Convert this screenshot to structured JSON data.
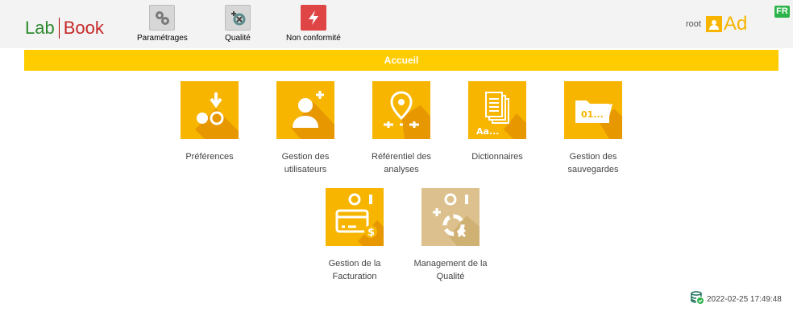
{
  "brand": {
    "part1": "Lab",
    "part2": "Book"
  },
  "nav": [
    {
      "label": "Paramétrages",
      "icon": "gears-icon"
    },
    {
      "label": "Qualité",
      "icon": "quality-icon"
    },
    {
      "label": "Non conformité",
      "icon": "lightning-icon"
    }
  ],
  "user": {
    "name": "root",
    "avatar_text": "Ad"
  },
  "lang": "FR",
  "banner": {
    "title": "Accueil"
  },
  "tiles": [
    {
      "label": "Préférences",
      "icon": "preferences-icon"
    },
    {
      "label": "Gestion des utilisateurs",
      "icon": "add-user-icon"
    },
    {
      "label": "Référentiel des analyses",
      "icon": "location-pin-icon"
    },
    {
      "label": "Dictionnaires",
      "icon": "documents-icon"
    },
    {
      "label": "Gestion des sauvegardes",
      "icon": "folder-icon"
    },
    {
      "label": "Gestion de la Facturation",
      "icon": "credit-card-icon"
    },
    {
      "label": "Management de la Qualité",
      "icon": "quality-management-icon"
    }
  ],
  "tile_text": {
    "dictionary_badge": "Aa...",
    "folder_badge": "01...",
    "currency": "$"
  },
  "footer": {
    "datetime": "2022-02-25 17:49:48",
    "icon": "database-check-icon"
  },
  "colors": {
    "accent": "#ffcc00",
    "tile_yellow": "#f7b500",
    "tile_shadow": "#e08a00",
    "tile_disabled": "#dcc18e",
    "brand_green": "#2e8a2e",
    "brand_red": "#c62828"
  }
}
